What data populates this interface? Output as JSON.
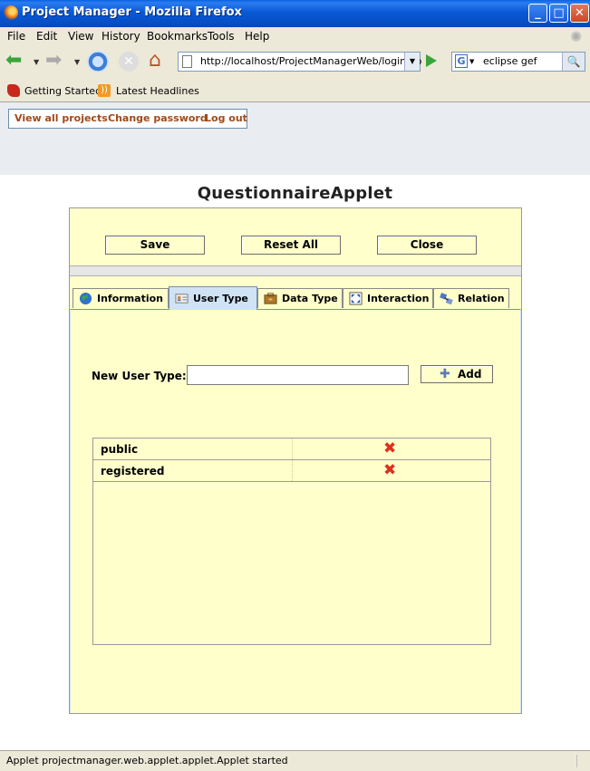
{
  "window": {
    "title": "Project Manager - Mozilla Firefox"
  },
  "menu": [
    "File",
    "Edit",
    "View",
    "History",
    "Bookmarks",
    "Tools",
    "Help"
  ],
  "toolbar": {
    "url": "http://localhost/ProjectManagerWeb/login.do",
    "search_value": "eclipse gef",
    "search_engine": "G"
  },
  "bookmarks": [
    "Getting Started",
    "Latest Headlines"
  ],
  "page": {
    "links": [
      "View all projects",
      "Change password",
      "Log out"
    ],
    "applet_title": "QuestionnaireApplet"
  },
  "applet": {
    "buttons": {
      "save": "Save",
      "reset": "Reset All",
      "close": "Close"
    },
    "tabs": [
      "Information",
      "User Type",
      "Data Type",
      "Interaction",
      "Relation"
    ],
    "active_tab": "User Type",
    "form": {
      "label": "New User Type:",
      "value": "",
      "add_label": "Add"
    },
    "user_types": [
      "public",
      "registered"
    ]
  },
  "status": {
    "text": "Applet projectmanager.web.applet.applet.Applet started"
  },
  "colors": {
    "applet_bg": "#ffffcc",
    "active_tab": "#cfe3f5",
    "link": "#a04a1a",
    "delete": "#e0301e"
  }
}
